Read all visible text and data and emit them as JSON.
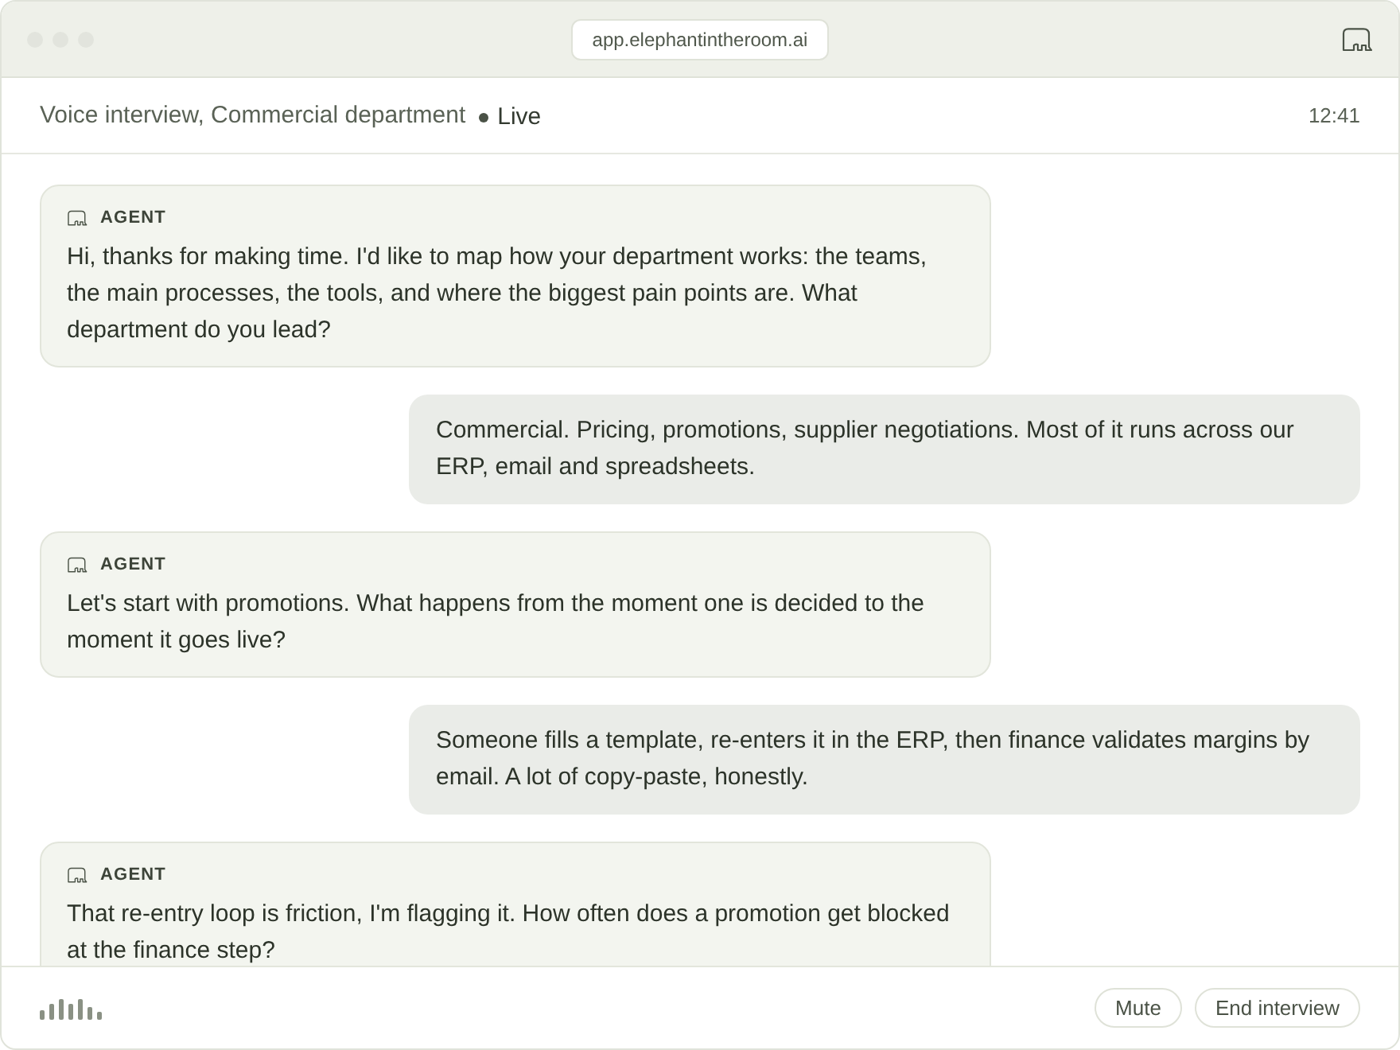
{
  "window": {
    "url": "app.elephantintheroom.ai"
  },
  "header": {
    "title": "Voice interview, Commercial department",
    "status": "Live",
    "time": "12:41"
  },
  "messages": [
    {
      "kind": "agent",
      "label": "AGENT",
      "text": "Hi, thanks for making time. I'd like to map how your department works: the teams, the main processes, the tools, and where the biggest pain points are. What department do you lead?"
    },
    {
      "kind": "user",
      "text": "Commercial. Pricing, promotions, supplier negotiations. Most of it runs across our ERP, email and spreadsheets."
    },
    {
      "kind": "agent",
      "label": "AGENT",
      "text": "Let's start with promotions. What happens from the moment one is decided to the moment it goes live?"
    },
    {
      "kind": "user",
      "text": "Someone fills a template, re-enters it in the ERP, then finance validates margins by email. A lot of copy-paste, honestly."
    },
    {
      "kind": "agent",
      "label": "AGENT",
      "text": "That re-entry loop is friction, I'm flagging it. How often does a promotion get blocked at the finance step?"
    }
  ],
  "footer": {
    "buttons": [
      "Mute",
      "End interview"
    ]
  }
}
